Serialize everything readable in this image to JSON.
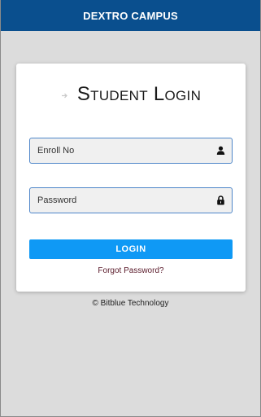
{
  "appbar": {
    "title": "DEXTRO CAMPUS"
  },
  "login_card": {
    "title": "Student Login",
    "title_icon": "arrow-right-icon",
    "enroll_field": {
      "placeholder": "Enroll No",
      "value": "",
      "icon": "user-icon"
    },
    "password_field": {
      "placeholder": "Password",
      "value": "",
      "icon": "lock-icon"
    },
    "login_button": "LOGIN",
    "forgot_link": "Forgot Password?"
  },
  "footer": {
    "text": "© Bitblue Technology"
  },
  "colors": {
    "appbar_bg": "#0a4f8e",
    "button_bg": "#0f99f5",
    "field_border": "#4e86c9",
    "page_bg": "#dcdcdc"
  }
}
